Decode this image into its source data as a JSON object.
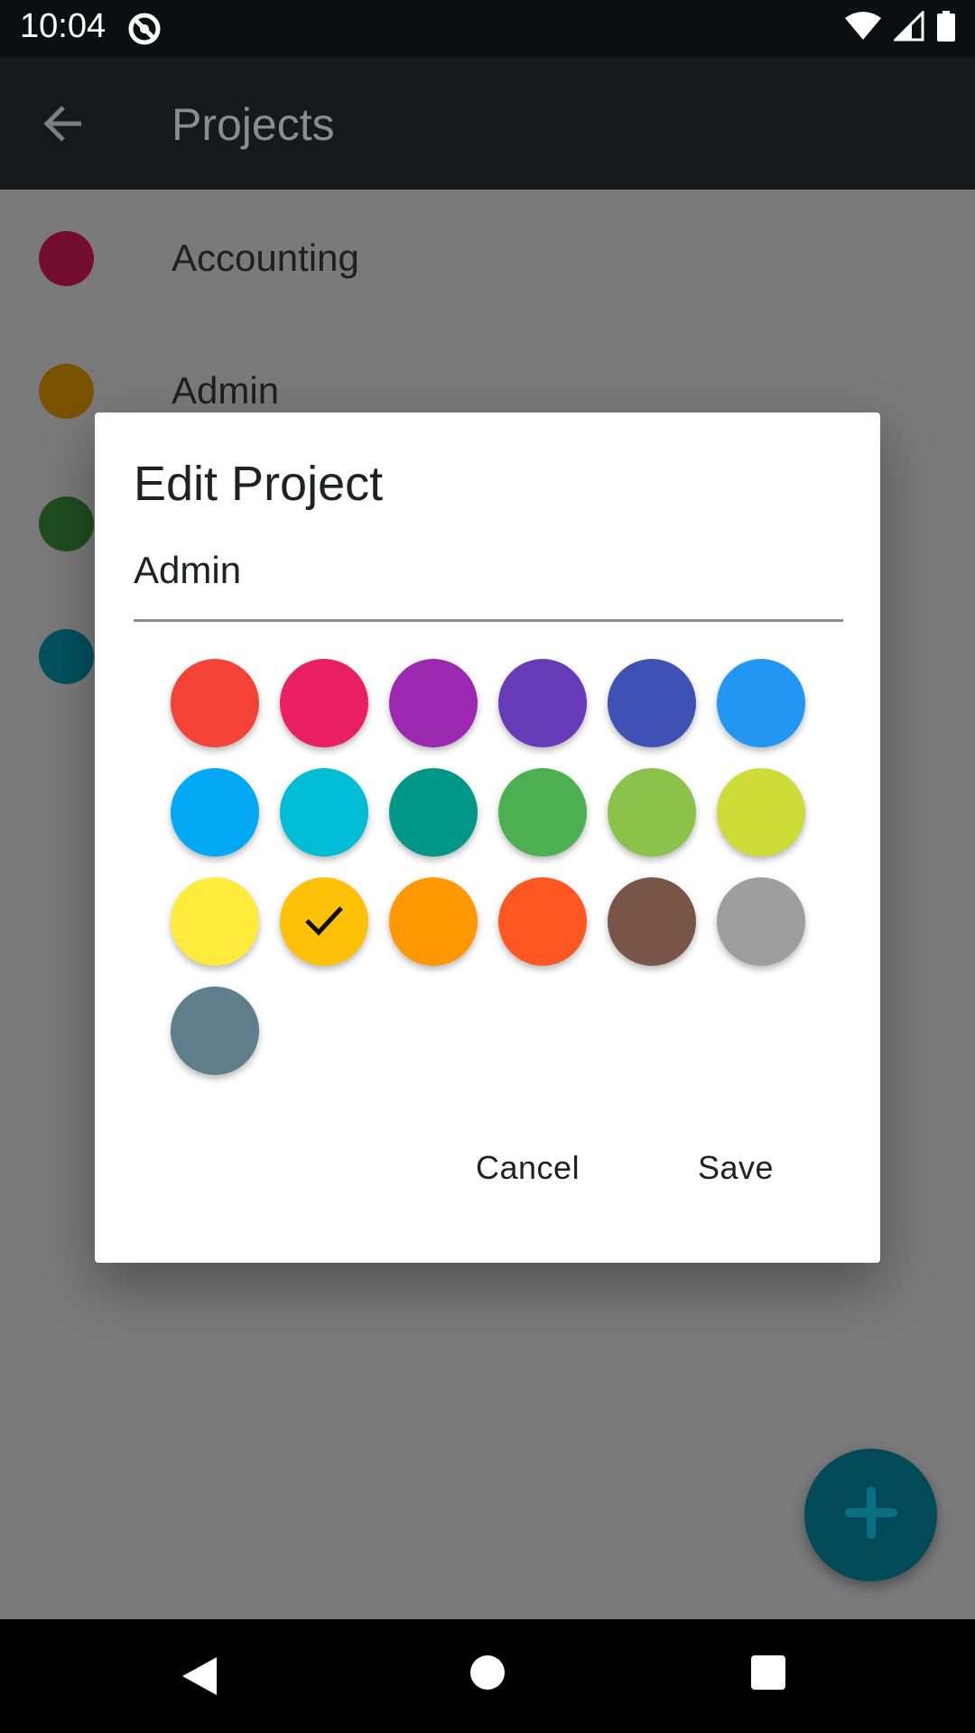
{
  "status_bar": {
    "time": "10:04"
  },
  "app_bar": {
    "title": "Projects"
  },
  "projects": [
    {
      "label": "Accounting",
      "color": "#720d2f"
    },
    {
      "label": "Admin",
      "color": "#7a5300"
    },
    {
      "label": "",
      "color": "#1f4d20"
    },
    {
      "label": "",
      "color": "#00505e"
    }
  ],
  "dialog": {
    "title": "Edit Project",
    "name_value": "Admin",
    "cancel_label": "Cancel",
    "save_label": "Save",
    "selected_color": "amber",
    "swatches": [
      {
        "name": "red",
        "color": "#f44336"
      },
      {
        "name": "pink",
        "color": "#e91e63"
      },
      {
        "name": "purple",
        "color": "#9c27b0"
      },
      {
        "name": "deep-purple",
        "color": "#673ab7"
      },
      {
        "name": "indigo",
        "color": "#3f51b5"
      },
      {
        "name": "blue",
        "color": "#2196f3"
      },
      {
        "name": "light-blue",
        "color": "#03a9f4"
      },
      {
        "name": "cyan",
        "color": "#00bcd4"
      },
      {
        "name": "teal",
        "color": "#009688"
      },
      {
        "name": "green",
        "color": "#4caf50"
      },
      {
        "name": "light-green",
        "color": "#8bc34a"
      },
      {
        "name": "lime",
        "color": "#cddc39"
      },
      {
        "name": "yellow",
        "color": "#ffeb3b"
      },
      {
        "name": "amber",
        "color": "#ffc107"
      },
      {
        "name": "orange",
        "color": "#ff9800"
      },
      {
        "name": "deep-orange",
        "color": "#ff5722"
      },
      {
        "name": "brown",
        "color": "#795548"
      },
      {
        "name": "grey",
        "color": "#9e9e9e"
      },
      {
        "name": "blue-grey",
        "color": "#607d8b"
      }
    ]
  },
  "fab": {
    "icon": "add-icon",
    "color": "#024a58"
  }
}
